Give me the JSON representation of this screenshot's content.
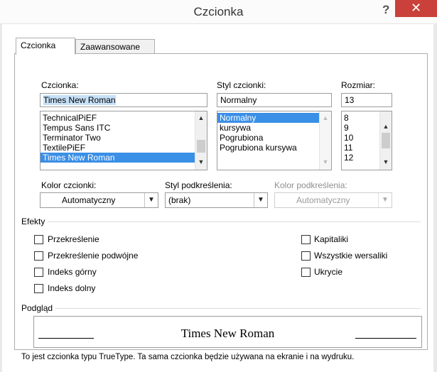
{
  "window": {
    "title": "Czcionka",
    "help": "?",
    "close": "✕"
  },
  "tabs": [
    {
      "label": "Czcionka",
      "active": true
    },
    {
      "label": "Zaawansowane",
      "active": false
    }
  ],
  "font": {
    "label": "Czcionka:",
    "value": "Times New Roman",
    "items": [
      "TechnicalPiEF",
      "Tempus Sans ITC",
      "Terminator Two",
      "TextilePiEF",
      "Times New Roman"
    ],
    "selected": "Times New Roman"
  },
  "style": {
    "label": "Styl czcionki:",
    "value": "Normalny",
    "items": [
      "Normalny",
      "kursywa",
      "Pogrubiona",
      "Pogrubiona kursywa"
    ],
    "selected": "Normalny"
  },
  "size": {
    "label": "Rozmiar:",
    "value": "13",
    "items": [
      "8",
      "9",
      "10",
      "11",
      "12"
    ]
  },
  "font_color": {
    "label": "Kolor czcionki:",
    "value": "Automatyczny"
  },
  "underline_style": {
    "label": "Styl podkreślenia:",
    "value": "(brak)"
  },
  "underline_color": {
    "label": "Kolor podkreślenia:",
    "value": "Automatyczny",
    "disabled": true
  },
  "effects": {
    "title": "Efekty",
    "left": [
      {
        "label": "Przekreślenie",
        "checked": false
      },
      {
        "label": "Przekreślenie podwójne",
        "checked": false
      },
      {
        "label": "Indeks górny",
        "checked": false
      },
      {
        "label": "Indeks dolny",
        "checked": false
      }
    ],
    "right": [
      {
        "label": "Kapitaliki",
        "checked": false
      },
      {
        "label": "Wszystkie wersaliki",
        "checked": false
      },
      {
        "label": "Ukrycie",
        "checked": false
      }
    ]
  },
  "preview": {
    "title": "Podgląd",
    "sample": "Times New Roman",
    "note": "To jest czcionka typu TrueType. Ta sama czcionka będzie używana na ekranie i na wydruku."
  }
}
